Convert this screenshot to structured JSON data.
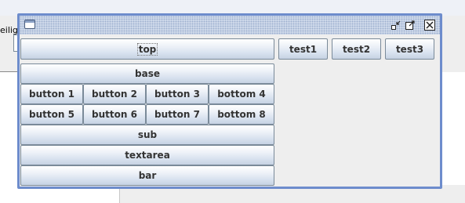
{
  "background": {
    "partial_label": "eilig"
  },
  "frame": {
    "controls": {
      "iconify": "iconify-icon",
      "maximize": "maximize-icon",
      "close": "close-icon"
    },
    "buttons": {
      "top": "top",
      "base": "base",
      "grid": [
        "button 1",
        "button 2",
        "button 3",
        "bottom 4",
        "button 5",
        "button 6",
        "button 7",
        "bottom 8"
      ],
      "sub": "sub",
      "textarea": "textarea",
      "bar": "bar",
      "tests": [
        "test1",
        "test2",
        "test3"
      ]
    }
  },
  "colors": {
    "frame_border": "#6d8ccc",
    "titlebar": "#d7e0ef"
  }
}
